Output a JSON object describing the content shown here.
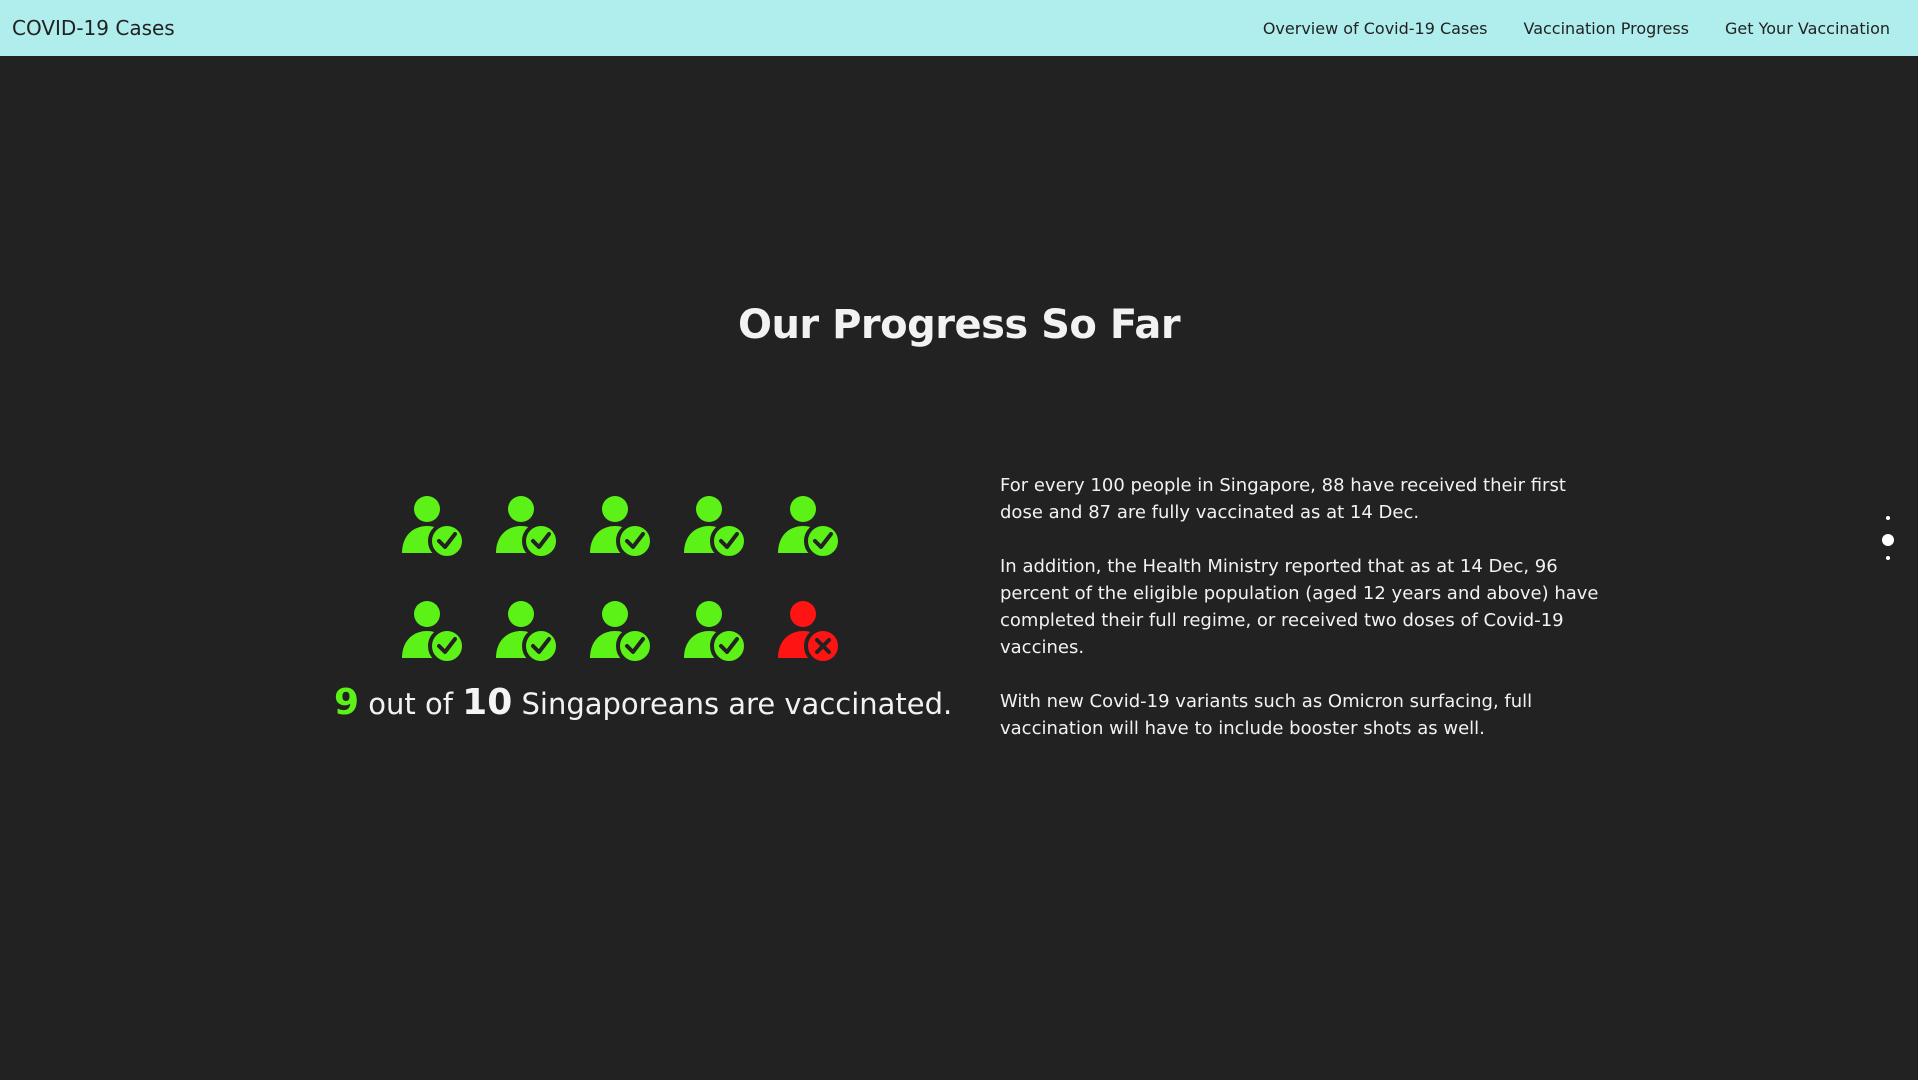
{
  "navbar": {
    "brand": "COVID-19 Cases",
    "links": [
      {
        "label": "Overview of Covid-19 Cases"
      },
      {
        "label": "Vaccination Progress"
      },
      {
        "label": "Get Your Vaccination"
      }
    ],
    "background": "#b0eded"
  },
  "section": {
    "title": "Our Progress So Far",
    "vaccinated_icons": 9,
    "unvaccinated_icons": 1,
    "colors": {
      "vaccinated": "#5cf218",
      "unvaccinated": "#ff1414",
      "background": "#222222"
    },
    "summary": {
      "count": "9",
      "text1": "out of",
      "total": "10",
      "text2": "Singaporeans are vaccinated."
    },
    "paragraphs": [
      "For every 100 people in Singapore, 88 have received their first dose and 87 are fully vaccinated as at 14 Dec.",
      "In addition, the Health Ministry reported that as at 14 Dec, 96 percent of the eligible population (aged 12 years and above) have completed their full regime, or received two doses of Covid-19 vaccines.",
      "With new Covid-19 variants such as Omicron surfacing, full vaccination will have to include booster shots as well."
    ]
  },
  "page_nav": {
    "dots": 3,
    "active_index": 1
  }
}
